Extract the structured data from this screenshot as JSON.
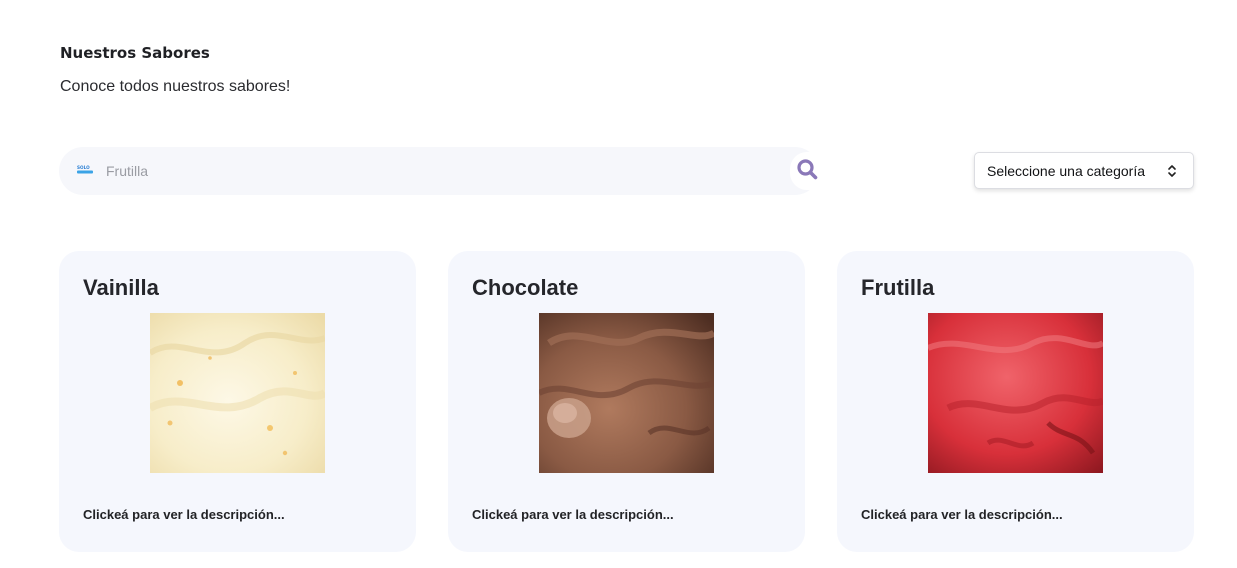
{
  "header": {
    "title": "Nuestros Sabores",
    "subtitle": "Conoce todos nuestros sabores!"
  },
  "search": {
    "value": "",
    "placeholder": "Frutilla",
    "logo_icon": "brand-logo-icon",
    "button_icon": "search-icon",
    "accent_color": "#8a78b8"
  },
  "category_filter": {
    "selected": "Seleccione una categoría",
    "icon": "chevron-updown-icon"
  },
  "flavors": [
    {
      "name": "Vainilla",
      "description": "Clickeá para ver la descripción...",
      "image_color": "#f7edc9"
    },
    {
      "name": "Chocolate",
      "description": "Clickeá para ver la descripción...",
      "image_color": "#8a5a44"
    },
    {
      "name": "Frutilla",
      "description": "Clickeá para ver la descripción...",
      "image_color": "#d8303a"
    }
  ]
}
